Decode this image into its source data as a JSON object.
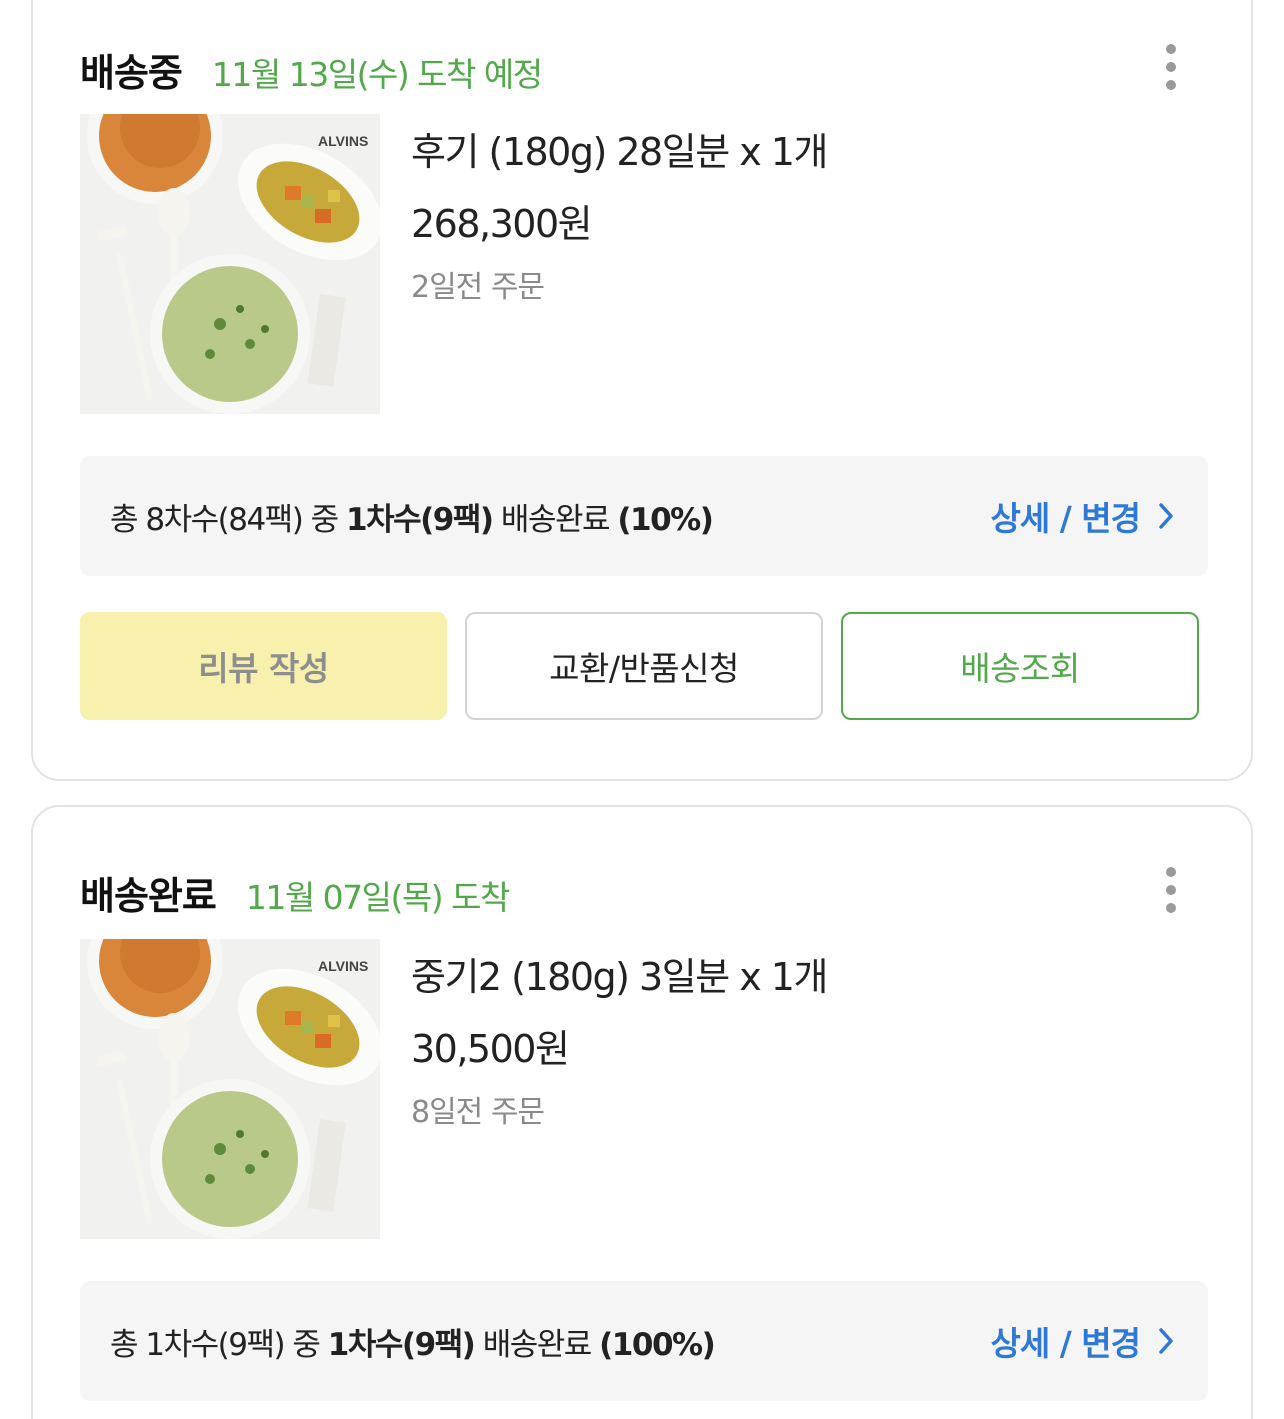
{
  "orders": [
    {
      "status": "배송중",
      "date": "11월 13일(수) 도착 예정",
      "product_name": "후기 (180g) 28일분 x 1개",
      "price": "268,300원",
      "ordered_ago": "2일전 주문",
      "thumb_brand": "ALVINS",
      "progress": {
        "prefix": "총 8차수(84팩) 중 ",
        "bold": "1차수(9팩)",
        "middle": " 배송완료 ",
        "percent": "(10%)"
      },
      "detail_link": "상세 / 변경"
    },
    {
      "status": "배송완료",
      "date": "11월 07일(목) 도착",
      "product_name": "중기2 (180g) 3일분 x 1개",
      "price": "30,500원",
      "ordered_ago": "8일전 주문",
      "thumb_brand": "ALVINS",
      "progress": {
        "prefix": "총 1차수(9팩) 중 ",
        "bold": "1차수(9팩)",
        "middle": " 배송완료 ",
        "percent": "(100%)"
      },
      "detail_link": "상세 / 변경"
    }
  ],
  "actions": {
    "review": "리뷰 작성",
    "return": "교환/반품신청",
    "track": "배송조회"
  },
  "colors": {
    "accent_green": "#52a84a",
    "link_blue": "#2f79d6",
    "review_yellow": "#f8f0ad"
  },
  "icons": [
    "more-vertical-icon",
    "chevron-right-icon"
  ]
}
